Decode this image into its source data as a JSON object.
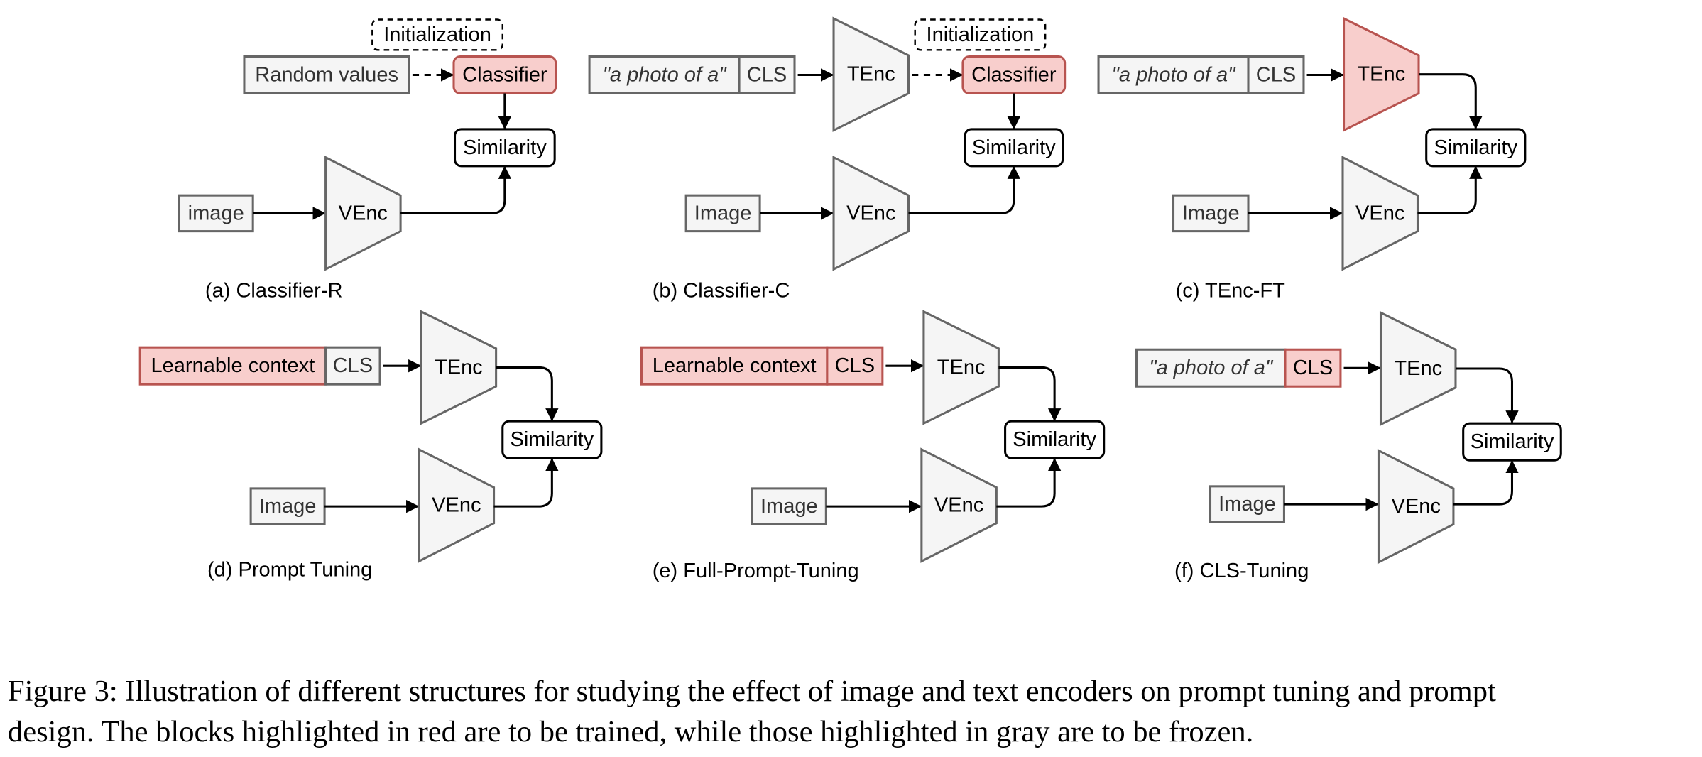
{
  "colors": {
    "trained_fill": "#f8cecc",
    "trained_stroke": "#b85450",
    "frozen_fill": "#f5f5f5",
    "frozen_stroke": "#666666",
    "neutral_fill": "#ffffff",
    "neutral_stroke": "#000000"
  },
  "panels": [
    {
      "id": "a",
      "caption": "(a) Classifier-R",
      "init_label": "Initialization",
      "text_input": [
        {
          "text": "Random values",
          "state": "frozen",
          "italic": false
        }
      ],
      "text_encoder": null,
      "classifier": {
        "label": "Classifier",
        "state": "trained"
      },
      "image_input": "image",
      "vision_encoder": {
        "label": "VEnc",
        "state": "frozen"
      },
      "similarity": "Similarity"
    },
    {
      "id": "b",
      "caption": "(b) Classifier-C",
      "init_label": "Initialization",
      "text_input": [
        {
          "text": "\"a photo of a\"",
          "state": "frozen",
          "italic": true
        },
        {
          "text": "CLS",
          "state": "frozen",
          "italic": false
        }
      ],
      "text_encoder": {
        "label": "TEnc",
        "state": "frozen"
      },
      "classifier": {
        "label": "Classifier",
        "state": "trained"
      },
      "image_input": "Image",
      "vision_encoder": {
        "label": "VEnc",
        "state": "frozen"
      },
      "similarity": "Similarity"
    },
    {
      "id": "c",
      "caption": "(c) TEnc-FT",
      "text_input": [
        {
          "text": "\"a photo of a\"",
          "state": "frozen",
          "italic": true
        },
        {
          "text": "CLS",
          "state": "frozen",
          "italic": false
        }
      ],
      "text_encoder": {
        "label": "TEnc",
        "state": "trained"
      },
      "image_input": "Image",
      "vision_encoder": {
        "label": "VEnc",
        "state": "frozen"
      },
      "similarity": "Similarity"
    },
    {
      "id": "d",
      "caption": "(d) Prompt Tuning",
      "text_input": [
        {
          "text": "Learnable context",
          "state": "trained",
          "italic": false
        },
        {
          "text": "CLS",
          "state": "frozen",
          "italic": false
        }
      ],
      "text_encoder": {
        "label": "TEnc",
        "state": "frozen"
      },
      "image_input": "Image",
      "vision_encoder": {
        "label": "VEnc",
        "state": "frozen"
      },
      "similarity": "Similarity"
    },
    {
      "id": "e",
      "caption": "(e) Full-Prompt-Tuning",
      "text_input": [
        {
          "text": "Learnable context",
          "state": "trained",
          "italic": false
        },
        {
          "text": "CLS",
          "state": "trained",
          "italic": false
        }
      ],
      "text_encoder": {
        "label": "TEnc",
        "state": "frozen"
      },
      "image_input": "Image",
      "vision_encoder": {
        "label": "VEnc",
        "state": "frozen"
      },
      "similarity": "Similarity"
    },
    {
      "id": "f",
      "caption": "(f) CLS-Tuning",
      "text_input": [
        {
          "text": "\"a photo of a\"",
          "state": "frozen",
          "italic": true
        },
        {
          "text": "CLS",
          "state": "trained",
          "italic": false
        }
      ],
      "text_encoder": {
        "label": "TEnc",
        "state": "frozen"
      },
      "image_input": "Image",
      "vision_encoder": {
        "label": "VEnc",
        "state": "frozen"
      },
      "similarity": "Similarity"
    }
  ],
  "caption": {
    "line1": "Figure 3: Illustration of different structures for studying the effect of image and text encoders on prompt tuning and prompt",
    "line2": "design. The blocks highlighted in red are to be trained, while those highlighted in gray are to be frozen."
  }
}
